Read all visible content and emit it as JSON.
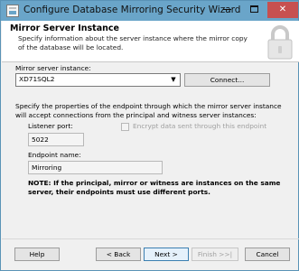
{
  "window": {
    "title": "Configure Database Mirroring Security Wizard",
    "controls": {
      "minimize": "",
      "maximize": "",
      "close": "✕"
    }
  },
  "header": {
    "title": "Mirror Server Instance",
    "description": "Specify information about the server instance where the mirror copy of the database will be located."
  },
  "form": {
    "server_instance_label": "Mirror server instance:",
    "server_instance_value": "XD71SQL2",
    "connect_button": "Connect...",
    "endpoint_description": "Specify the properties of the endpoint through which the mirror server instance will accept connections from the principal and witness server instances:",
    "listener_port_label": "Listener port:",
    "listener_port_value": "5022",
    "encrypt_label": "Encrypt data sent through this endpoint",
    "encrypt_checked": false,
    "endpoint_name_label": "Endpoint name:",
    "endpoint_name_value": "Mirroring",
    "note": "NOTE: If the principal, mirror or witness are instances on the same server, their endpoints must use different ports."
  },
  "footer": {
    "help": "Help",
    "back": "< Back",
    "next": "Next >",
    "finish": "Finish >>|",
    "cancel": "Cancel"
  },
  "colors": {
    "titlebar": "#6aa5c9",
    "close_button": "#c75050",
    "default_button_border": "#3c7fb1"
  }
}
